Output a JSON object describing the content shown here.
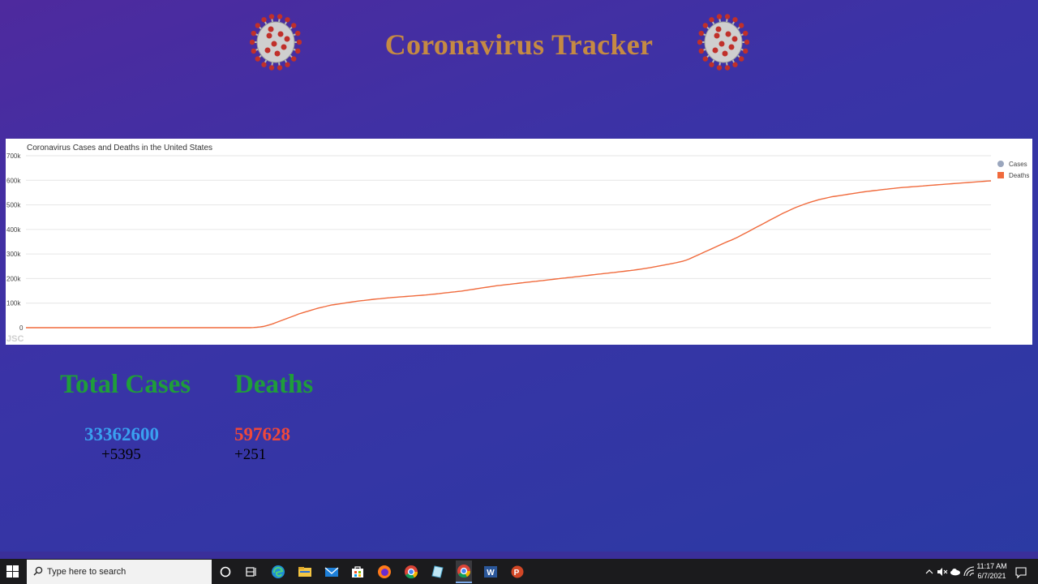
{
  "page": {
    "title": "Coronavirus Tracker"
  },
  "chart_data": {
    "type": "line",
    "title": "Coronavirus Cases and Deaths in the United States",
    "ylim": [
      0,
      700000
    ],
    "yticks": [
      "0",
      "100k",
      "200k",
      "300k",
      "400k",
      "500k",
      "600k",
      "700k"
    ],
    "legend_position": "top-right",
    "grid": true,
    "watermark": "JSC",
    "series": [
      {
        "name": "Cases",
        "color": "#9aa6bd",
        "values": []
      },
      {
        "name": "Deaths",
        "color": "#f06a3c",
        "values": [
          0,
          0,
          0,
          0,
          0,
          0,
          0,
          0,
          0,
          0,
          0,
          0,
          0,
          0,
          0,
          0,
          0,
          0,
          0,
          0,
          0,
          0,
          0,
          0,
          0,
          0,
          0,
          0,
          0,
          0,
          0,
          0,
          0,
          0,
          0,
          0,
          0,
          0,
          0,
          0,
          0,
          0,
          0,
          0,
          0,
          0,
          0,
          0,
          0,
          0,
          0,
          0,
          0,
          0,
          0,
          0,
          0,
          0,
          0,
          0,
          0,
          0,
          0,
          0,
          0,
          0,
          0,
          0,
          0,
          0,
          500,
          1500,
          3000,
          5000,
          8000,
          12000,
          16000,
          21000,
          26000,
          31000,
          36000,
          41000,
          46000,
          51000,
          56000,
          60000,
          64000,
          68000,
          72000,
          76000,
          80000,
          83000,
          86000,
          89000,
          92000,
          94000,
          96000,
          98000,
          100000,
          102000,
          104000,
          106000,
          108000,
          109500,
          111000,
          112500,
          114000,
          115500,
          117000,
          118000,
          119500,
          121000,
          122000,
          123000,
          124000,
          125000,
          126000,
          127000,
          128000,
          129000,
          130000,
          131000,
          132000,
          133000,
          134500,
          136000,
          137000,
          138500,
          140000,
          141500,
          143000,
          144500,
          146000,
          147500,
          149000,
          151000,
          153000,
          155000,
          157000,
          159000,
          161000,
          163000,
          165000,
          167000,
          169000,
          171000,
          172500,
          174000,
          175500,
          177000,
          178500,
          180000,
          181500,
          183000,
          184500,
          186000,
          187500,
          189000,
          190500,
          192000,
          193500,
          195000,
          196500,
          198000,
          199500,
          201000,
          202500,
          204000,
          205500,
          207000,
          208500,
          210000,
          211500,
          213000,
          214500,
          216000,
          217500,
          219000,
          220500,
          222000,
          223500,
          225000,
          226500,
          228000,
          229500,
          231000,
          232500,
          234000,
          236000,
          238000,
          240000,
          242000,
          244000,
          246500,
          249000,
          251500,
          254000,
          256500,
          259000,
          261500,
          264000,
          267000,
          270000,
          274000,
          279000,
          285000,
          291000,
          297000,
          303000,
          309000,
          315000,
          321000,
          327000,
          333000,
          339000,
          345000,
          351000,
          356000,
          362000,
          368000,
          375000,
          382000,
          389000,
          396000,
          403000,
          410000,
          417000,
          424000,
          431000,
          438000,
          445000,
          452000,
          459000,
          466000,
          472000,
          478000,
          484000,
          490000,
          495000,
          500000,
          505000,
          509000,
          513000,
          517000,
          521000,
          524000,
          527000,
          530000,
          533000,
          535000,
          537000,
          539000,
          541000,
          543000,
          545000,
          547000,
          549000,
          551000,
          553000,
          555000,
          556500,
          558000,
          559500,
          561000,
          562500,
          564000,
          565500,
          567000,
          568500,
          570000,
          571000,
          572000,
          573000,
          574000,
          575000,
          576000,
          577000,
          578000,
          579000,
          580000,
          581000,
          582000,
          583000,
          584000,
          585000,
          586000,
          587000,
          588000,
          589000,
          590000,
          591000,
          592000,
          593000,
          594000,
          595000,
          596000,
          597000,
          597628
        ]
      }
    ]
  },
  "stats": {
    "cases": {
      "label": "Total Cases",
      "value": "33362600",
      "delta": "+5395"
    },
    "deaths": {
      "label": "Deaths",
      "value": "597628",
      "delta": "+251"
    }
  },
  "taskbar": {
    "search_placeholder": "Type here to search",
    "time": "11:17 AM",
    "date": "6/7/2021",
    "apps": [
      "task-view-icon",
      "widgets-icon",
      "edge-icon",
      "file-explorer-icon",
      "mail-icon",
      "store-icon",
      "firefox-icon",
      "chrome-icon",
      "notepad-icon",
      "chrome-active-icon",
      "word-icon",
      "powerpoint-icon"
    ]
  }
}
